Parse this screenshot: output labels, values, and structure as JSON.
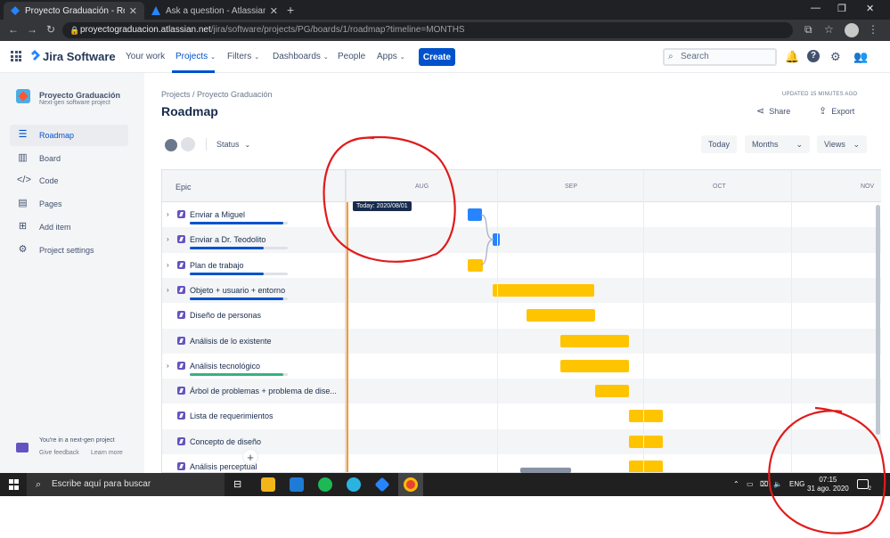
{
  "browser": {
    "tabs": [
      {
        "title": "Proyecto Graduación - Roadmap",
        "close": "✕"
      },
      {
        "title": "Ask a question - Atlassian Comm",
        "close": "✕"
      }
    ],
    "new_tab": "+",
    "url_host": "proyectograduacion.atlassian.net",
    "url_path": "/jira/software/projects/PG/boards/1/roadmap?timeline=MONTHS"
  },
  "nav": {
    "brand": "Jira Software",
    "items": [
      "Your work",
      "Projects",
      "Filters",
      "Dashboards",
      "People",
      "Apps"
    ],
    "create": "Create",
    "search_placeholder": "Search"
  },
  "sidebar": {
    "project_name": "Proyecto Graduación",
    "project_sub": "Next-gen software project",
    "items": [
      "Roadmap",
      "Board",
      "Code",
      "Pages",
      "Add item",
      "Project settings"
    ],
    "next_gen": "You're in a next-gen project",
    "feedback": "Give feedback",
    "learn": "Learn more"
  },
  "page": {
    "crumb": "Projects  /  Proyecto Graduación",
    "title": "Roadmap",
    "updated": "UPDATED 15 MINUTES AGO",
    "share": "Share",
    "export": "Export",
    "status": "Status",
    "today_btn": "Today",
    "months_btn": "Months",
    "views_btn": "Views"
  },
  "roadmap": {
    "epic_header": "Epic",
    "months": [
      "AUG",
      "SEP",
      "OCT",
      "NOV"
    ],
    "today_label": "Today: 2020/08/01",
    "epics": [
      {
        "name": "Enviar a Miguel",
        "expand": true,
        "progress_color": "#0052cc",
        "bar_color": "#2684ff"
      },
      {
        "name": "Enviar a Dr. Teodolito",
        "expand": true,
        "progress_color": "#0052cc",
        "bar_color": "#2684ff"
      },
      {
        "name": "Plan de trabajo",
        "expand": true,
        "progress_color": "#0052cc",
        "bar_color": "#ffc400"
      },
      {
        "name": "Objeto + usuario + entorno",
        "expand": true,
        "progress_color": "#0052cc",
        "bar_color": "#ffc400"
      },
      {
        "name": "Diseño de personas",
        "expand": false,
        "progress_color": "",
        "bar_color": "#ffc400"
      },
      {
        "name": "Análisis de lo existente",
        "expand": false,
        "progress_color": "",
        "bar_color": "#ffc400"
      },
      {
        "name": "Análisis tecnológico",
        "expand": true,
        "progress_color": "#36b37e",
        "bar_color": "#ffc400"
      },
      {
        "name": "Árbol de problemas + problema de dise...",
        "expand": false,
        "progress_color": "",
        "bar_color": "#ffc400"
      },
      {
        "name": "Lista de requerimientos",
        "expand": false,
        "progress_color": "",
        "bar_color": "#ffc400"
      },
      {
        "name": "Concepto de diseño",
        "expand": false,
        "progress_color": "",
        "bar_color": "#ffc400"
      },
      {
        "name": "Análisis perceptual",
        "expand": false,
        "progress_color": "",
        "bar_color": "#ffc400"
      }
    ]
  },
  "taskbar": {
    "search": "Escribe aquí para buscar",
    "lang": "ENG",
    "time": "07:15",
    "date": "31 ago. 2020",
    "notifications": "2"
  },
  "colors": {
    "accent": "#0052cc",
    "today": "#ff991f",
    "annotation": "#e01b1b"
  }
}
